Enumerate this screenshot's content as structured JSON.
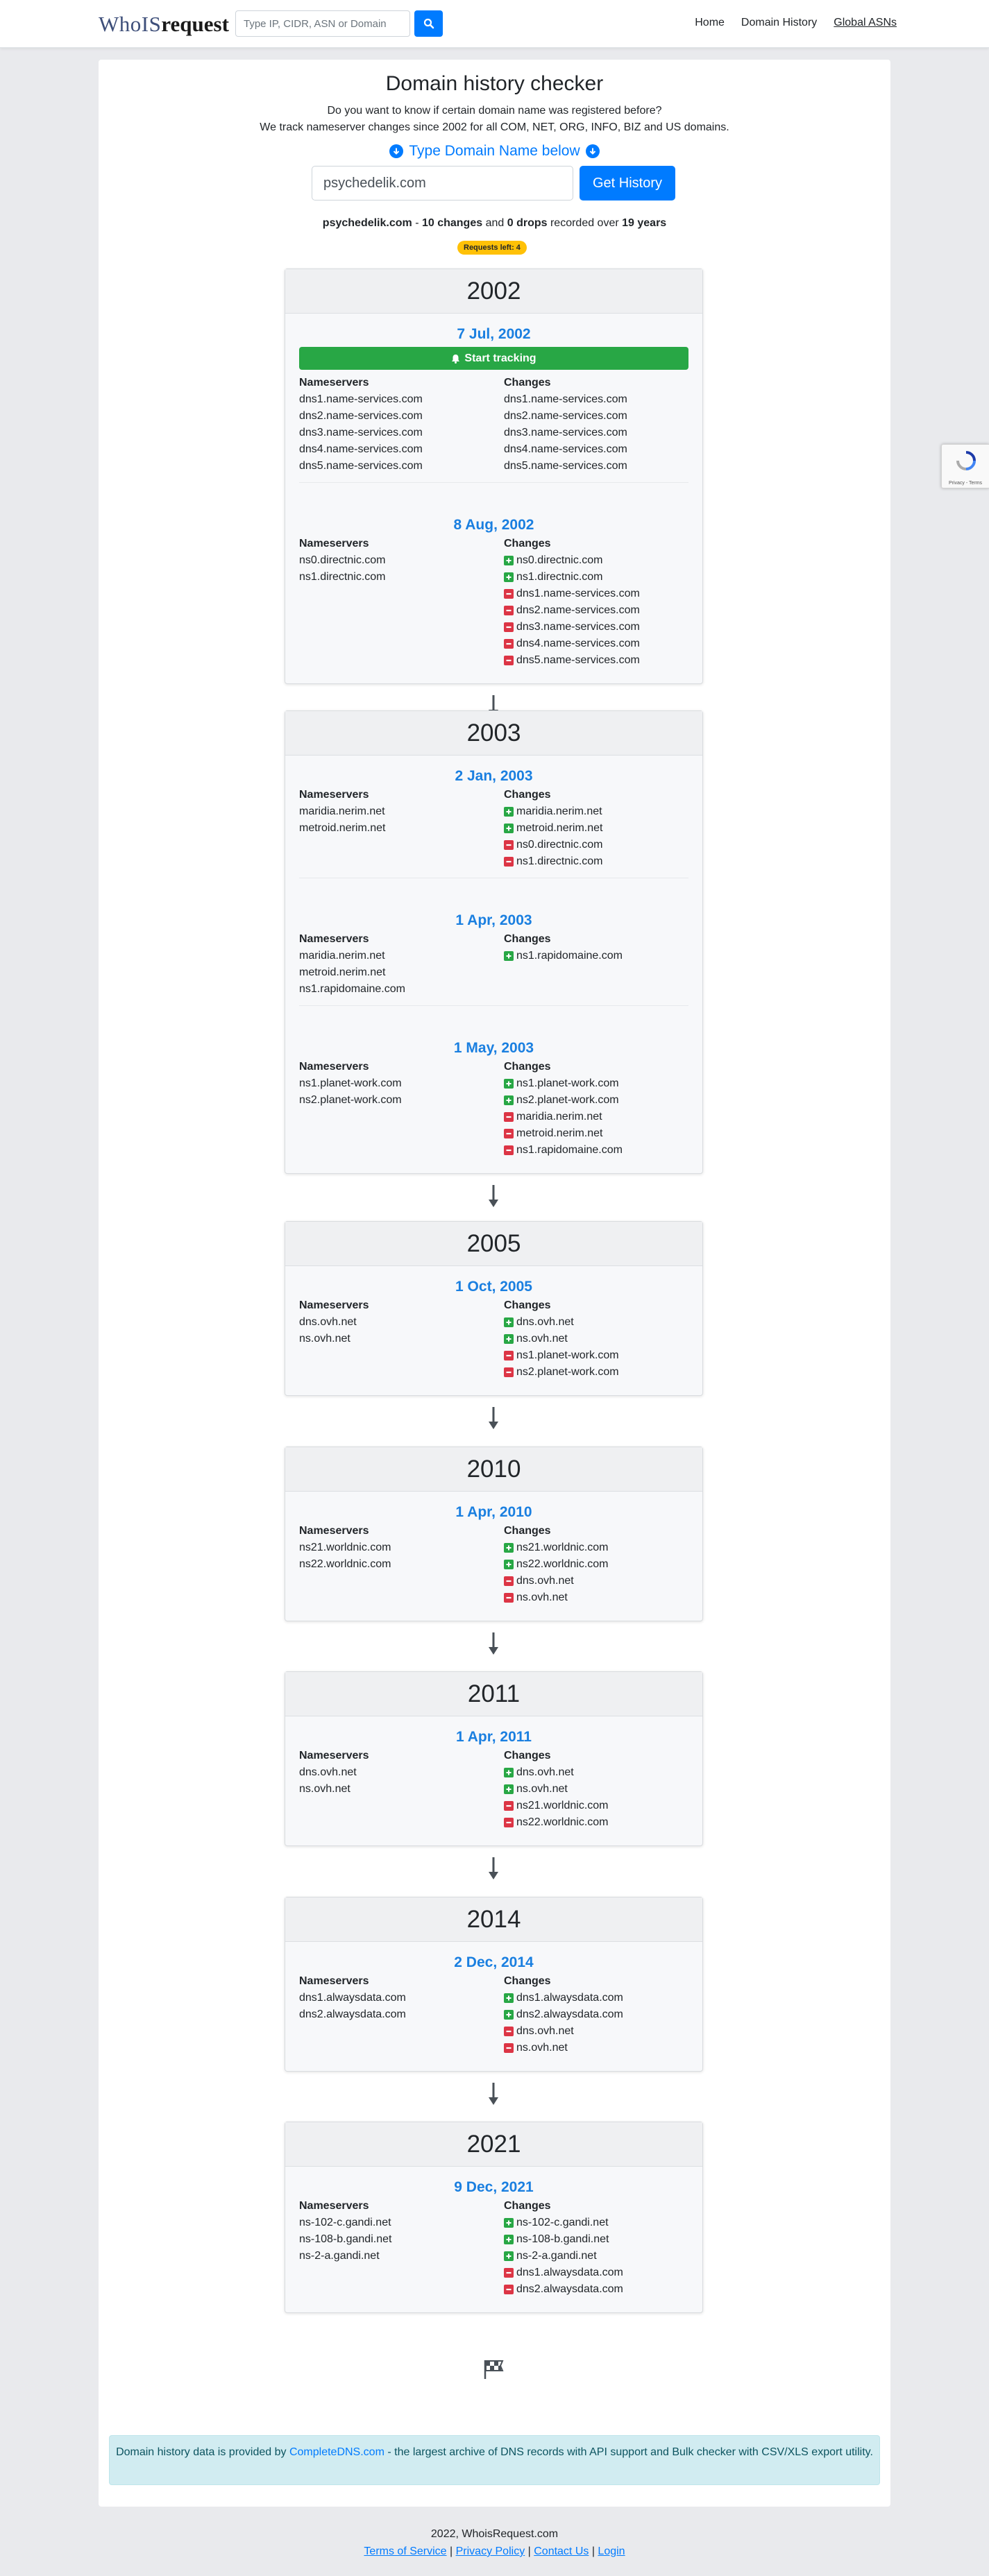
{
  "nav": {
    "logo_part1": "WhoIS",
    "logo_part2": "request",
    "search_placeholder": "Type IP, CIDR, ASN or Domain",
    "links": [
      "Home",
      "Domain History",
      "Global ASNs"
    ]
  },
  "page": {
    "title": "Domain history checker",
    "intro_line1": "Do you want to know if certain domain name was registered before?",
    "intro_line2": "We track nameserver changes since 2002 for all COM, NET, ORG, INFO, BIZ and US domains.",
    "type_label": "Type Domain Name below",
    "domain_value": "psychedelik.com",
    "submit_label": "Get History",
    "summary": {
      "domain": "psychedelik.com",
      "sep": " - ",
      "changes": "10 changes",
      "and": " and ",
      "drops": "0 drops",
      "recorded": " recorded over ",
      "years": "19 years"
    },
    "requests_left": "Requests left: 4"
  },
  "labels": {
    "nameservers": "Nameservers",
    "changes": "Changes",
    "start_tracking": "Start tracking"
  },
  "years": [
    {
      "year": "2002",
      "entries": [
        {
          "date": "7 Jul, 2002",
          "nameservers": [
            "dns1.name-services.com",
            "dns2.name-services.com",
            "dns3.name-services.com",
            "dns4.name-services.com",
            "dns5.name-services.com"
          ],
          "changes": [
            {
              "type": "none",
              "text": "dns1.name-services.com"
            },
            {
              "type": "none",
              "text": "dns2.name-services.com"
            },
            {
              "type": "none",
              "text": "dns3.name-services.com"
            },
            {
              "type": "none",
              "text": "dns4.name-services.com"
            },
            {
              "type": "none",
              "text": "dns5.name-services.com"
            }
          ]
        },
        {
          "date": "8 Aug, 2002",
          "nameservers": [
            "ns0.directnic.com",
            "ns1.directnic.com"
          ],
          "changes": [
            {
              "type": "add",
              "text": "ns0.directnic.com"
            },
            {
              "type": "add",
              "text": "ns1.directnic.com"
            },
            {
              "type": "rm",
              "text": "dns1.name-services.com"
            },
            {
              "type": "rm",
              "text": "dns2.name-services.com"
            },
            {
              "type": "rm",
              "text": "dns3.name-services.com"
            },
            {
              "type": "rm",
              "text": "dns4.name-services.com"
            },
            {
              "type": "rm",
              "text": "dns5.name-services.com"
            }
          ]
        }
      ]
    },
    {
      "year": "2003",
      "entries": [
        {
          "date": "2 Jan, 2003",
          "nameservers": [
            "maridia.nerim.net",
            "metroid.nerim.net"
          ],
          "changes": [
            {
              "type": "add",
              "text": "maridia.nerim.net"
            },
            {
              "type": "add",
              "text": "metroid.nerim.net"
            },
            {
              "type": "rm",
              "text": "ns0.directnic.com"
            },
            {
              "type": "rm",
              "text": "ns1.directnic.com"
            }
          ]
        },
        {
          "date": "1 Apr, 2003",
          "nameservers": [
            "maridia.nerim.net",
            "metroid.nerim.net",
            "ns1.rapidomaine.com"
          ],
          "changes": [
            {
              "type": "add",
              "text": "ns1.rapidomaine.com"
            }
          ]
        },
        {
          "date": "1 May, 2003",
          "nameservers": [
            "ns1.planet-work.com",
            "ns2.planet-work.com"
          ],
          "changes": [
            {
              "type": "add",
              "text": "ns1.planet-work.com"
            },
            {
              "type": "add",
              "text": "ns2.planet-work.com"
            },
            {
              "type": "rm",
              "text": "maridia.nerim.net"
            },
            {
              "type": "rm",
              "text": "metroid.nerim.net"
            },
            {
              "type": "rm",
              "text": "ns1.rapidomaine.com"
            }
          ]
        }
      ]
    },
    {
      "year": "2005",
      "entries": [
        {
          "date": "1 Oct, 2005",
          "nameservers": [
            "dns.ovh.net",
            "ns.ovh.net"
          ],
          "changes": [
            {
              "type": "add",
              "text": "dns.ovh.net"
            },
            {
              "type": "add",
              "text": "ns.ovh.net"
            },
            {
              "type": "rm",
              "text": "ns1.planet-work.com"
            },
            {
              "type": "rm",
              "text": "ns2.planet-work.com"
            }
          ]
        }
      ]
    },
    {
      "year": "2010",
      "entries": [
        {
          "date": "1 Apr, 2010",
          "nameservers": [
            "ns21.worldnic.com",
            "ns22.worldnic.com"
          ],
          "changes": [
            {
              "type": "add",
              "text": "ns21.worldnic.com"
            },
            {
              "type": "add",
              "text": "ns22.worldnic.com"
            },
            {
              "type": "rm",
              "text": "dns.ovh.net"
            },
            {
              "type": "rm",
              "text": "ns.ovh.net"
            }
          ]
        }
      ]
    },
    {
      "year": "2011",
      "entries": [
        {
          "date": "1 Apr, 2011",
          "nameservers": [
            "dns.ovh.net",
            "ns.ovh.net"
          ],
          "changes": [
            {
              "type": "add",
              "text": "dns.ovh.net"
            },
            {
              "type": "add",
              "text": "ns.ovh.net"
            },
            {
              "type": "rm",
              "text": "ns21.worldnic.com"
            },
            {
              "type": "rm",
              "text": "ns22.worldnic.com"
            }
          ]
        }
      ]
    },
    {
      "year": "2014",
      "entries": [
        {
          "date": "2 Dec, 2014",
          "nameservers": [
            "dns1.alwaysdata.com",
            "dns2.alwaysdata.com"
          ],
          "changes": [
            {
              "type": "add",
              "text": "dns1.alwaysdata.com"
            },
            {
              "type": "add",
              "text": "dns2.alwaysdata.com"
            },
            {
              "type": "rm",
              "text": "dns.ovh.net"
            },
            {
              "type": "rm",
              "text": "ns.ovh.net"
            }
          ]
        }
      ]
    },
    {
      "year": "2021",
      "entries": [
        {
          "date": "9 Dec, 2021",
          "nameservers": [
            "ns-102-c.gandi.net",
            "ns-108-b.gandi.net",
            "ns-2-a.gandi.net"
          ],
          "changes": [
            {
              "type": "add",
              "text": "ns-102-c.gandi.net"
            },
            {
              "type": "add",
              "text": "ns-108-b.gandi.net"
            },
            {
              "type": "add",
              "text": "ns-2-a.gandi.net"
            },
            {
              "type": "rm",
              "text": "dns1.alwaysdata.com"
            },
            {
              "type": "rm",
              "text": "dns2.alwaysdata.com"
            }
          ]
        }
      ]
    }
  ],
  "footer_note": {
    "prefix": "Domain history data is provided by ",
    "link": "CompleteDNS.com",
    "suffix": " - the largest archive of DNS records with API support and Bulk checker with CSV/XLS export utility."
  },
  "bottom": {
    "copyright": "2022, WhoisRequest.com",
    "links": [
      "Terms of Service",
      "Privacy Policy",
      "Contact Us",
      "Login"
    ],
    "sep": " | "
  },
  "recaptcha": {
    "text": "Privacy - Terms"
  },
  "colors": {
    "primary": "#007bff",
    "success": "#28a745",
    "danger": "#dc3545",
    "warning": "#ffc107",
    "date_blue": "#1a7fe0"
  }
}
